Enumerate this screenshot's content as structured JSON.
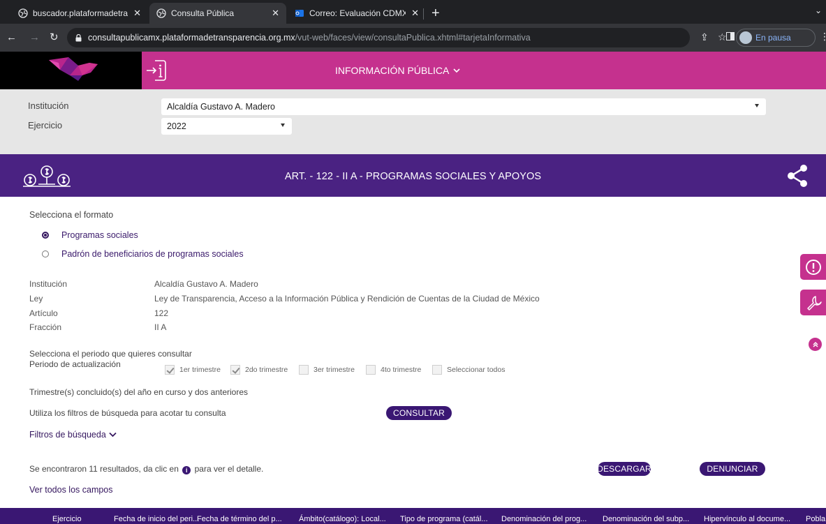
{
  "browser": {
    "tabs": [
      {
        "title": "buscador.plataformadetranspa",
        "active": false
      },
      {
        "title": "Consulta Pública",
        "active": true
      },
      {
        "title": "Correo: Evaluación CDMX - Ou",
        "active": false
      }
    ],
    "url_host": "consultapublicamx.plataformadetransparencia.org.mx",
    "url_path": "/vut-web/faces/view/consultaPublica.xhtml#tarjetaInformativa",
    "profile_label": "En pausa"
  },
  "header": {
    "menu_label": "INFORMACIÓN PÚBLICA",
    "bg_color": "#c5318e"
  },
  "filters": {
    "institucion_label": "Institución",
    "institucion_value": "Alcaldía Gustavo A. Madero",
    "ejercicio_label": "Ejercicio",
    "ejercicio_value": "2022"
  },
  "banner": {
    "title": "ART. - 122 - II A - PROGRAMAS SOCIALES Y APOYOS",
    "bg_color": "#4a2282"
  },
  "formato": {
    "prompt": "Selecciona el formato",
    "options": [
      {
        "label": "Programas sociales",
        "selected": true
      },
      {
        "label": "Padrón de beneficiarios de programas sociales",
        "selected": false
      }
    ]
  },
  "info": {
    "rows": [
      {
        "label": "Institución",
        "value": "Alcaldía Gustavo A. Madero"
      },
      {
        "label": "Ley",
        "value": "Ley de Transparencia, Acceso a la Información Pública y Rendición de Cuentas de la Ciudad de México"
      },
      {
        "label": "Artículo",
        "value": "122"
      },
      {
        "label": "Fracción",
        "value": "II A"
      }
    ]
  },
  "periodo": {
    "prompt": "Selecciona el periodo que quieres consultar",
    "label": "Periodo de actualización",
    "options": [
      {
        "label": "1er trimestre",
        "checked": true
      },
      {
        "label": "2do trimestre",
        "checked": true
      },
      {
        "label": "3er trimestre",
        "checked": false
      },
      {
        "label": "4to trimestre",
        "checked": false
      },
      {
        "label": "Seleccionar todos",
        "checked": false
      }
    ],
    "note": "Trimestre(s) concluido(s) del año en curso y dos anteriores"
  },
  "search": {
    "hint": "Utiliza los filtros de búsqueda para acotar tu consulta",
    "consultar_label": "CONSULTAR",
    "filtros_label": "Filtros de búsqueda"
  },
  "results": {
    "text_before": "Se encontraron 11 resultados, da clic en",
    "text_after": "para ver el detalle.",
    "descargar_label": "DESCARGAR",
    "denunciar_label": "DENUNCIAR",
    "ver_todos_label": "Ver todos los campos"
  },
  "table": {
    "columns": [
      "Ejercicio",
      "Fecha de inicio del peri...",
      "Fecha de término del p...",
      "Ámbito(catálogo): Local...",
      "Tipo de programa (catál...",
      "Denominación del prog...",
      "Denominación del subp...",
      "Hipervínculo al docume...",
      "Pobla"
    ]
  }
}
